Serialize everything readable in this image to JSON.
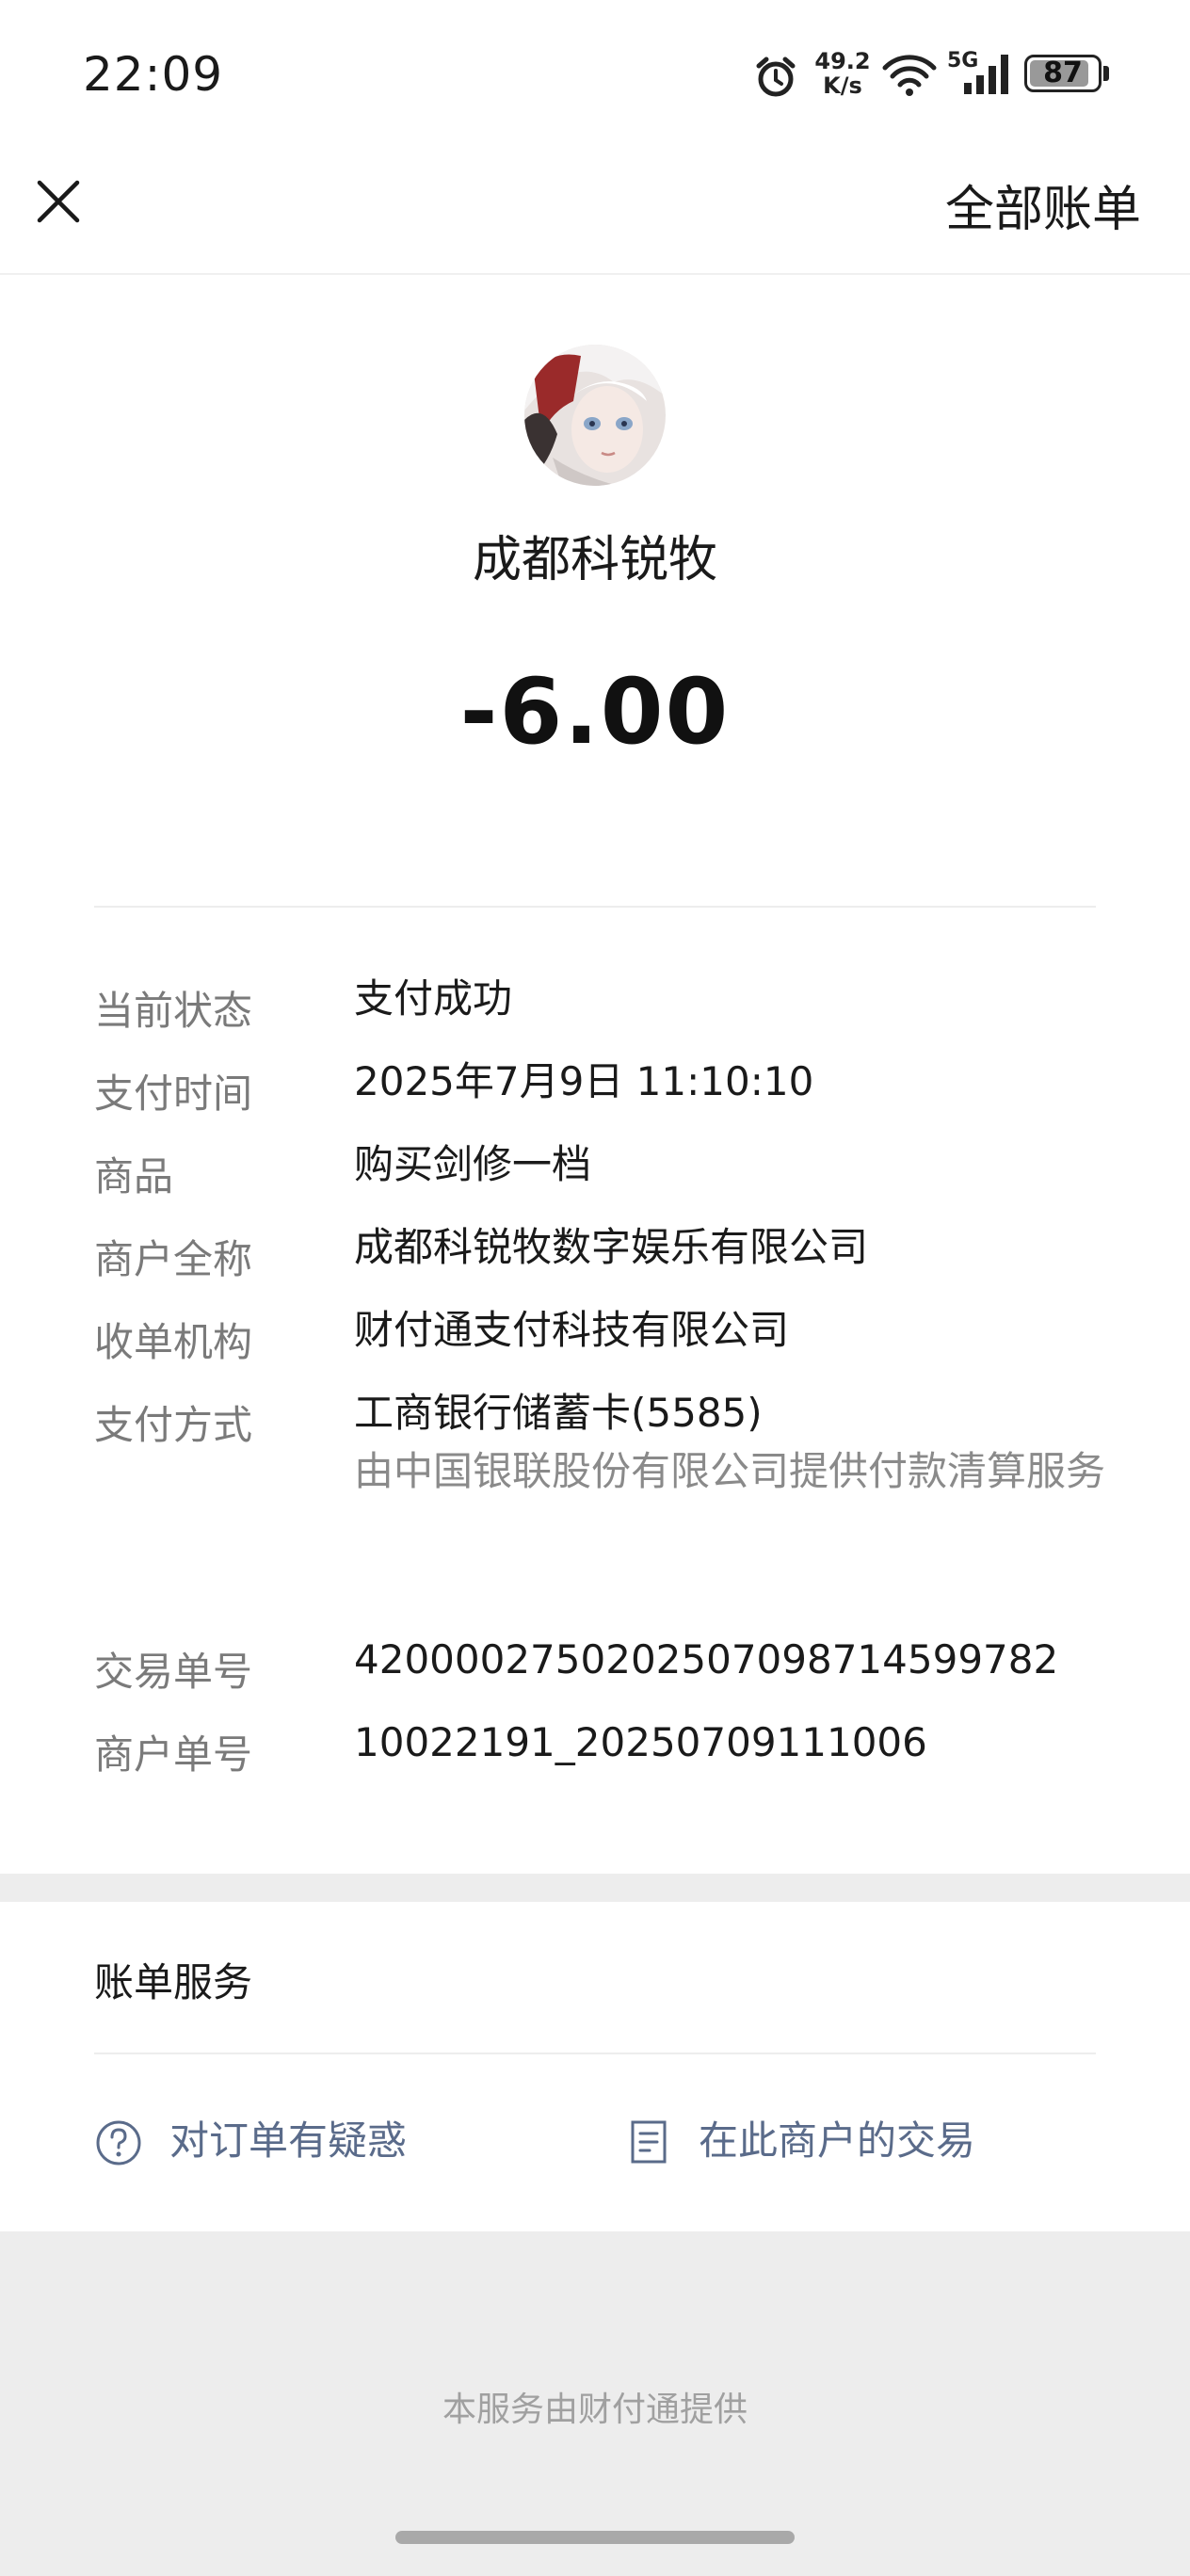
{
  "status_bar": {
    "time": "22:09",
    "net_speed_value": "49.2",
    "net_speed_unit": "K/s",
    "network": "5G",
    "battery": "87"
  },
  "nav": {
    "close_icon": "close-icon",
    "action_label": "全部账单"
  },
  "header": {
    "merchant_name": "成都科锐牧",
    "amount": "-6.00"
  },
  "details": [
    {
      "label": "当前状态",
      "value": "支付成功"
    },
    {
      "label": "支付时间",
      "value": "2025年7月9日 11:10:10"
    },
    {
      "label": "商品",
      "value": "购买剑修一档"
    },
    {
      "label": "商户全称",
      "value": "成都科锐牧数字娱乐有限公司"
    },
    {
      "label": "收单机构",
      "value": "财付通支付科技有限公司"
    },
    {
      "label": "支付方式",
      "value": "工商银行储蓄卡(5585)",
      "sub": "由中国银联股份有限公司提供付款清算服务"
    },
    {
      "label": "交易单号",
      "value": "4200002750202507098714599782"
    },
    {
      "label": "商户单号",
      "value": "10022191_20250709111006"
    }
  ],
  "services": {
    "title": "账单服务",
    "items": [
      {
        "label": "对订单有疑惑",
        "icon": "question-circle-icon"
      },
      {
        "label": "在此商户的交易",
        "icon": "document-list-icon"
      }
    ]
  },
  "footer": "本服务由财付通提供",
  "colors": {
    "link": "#5a6b8a",
    "label": "#7a7a7a",
    "background": "#ededed"
  }
}
